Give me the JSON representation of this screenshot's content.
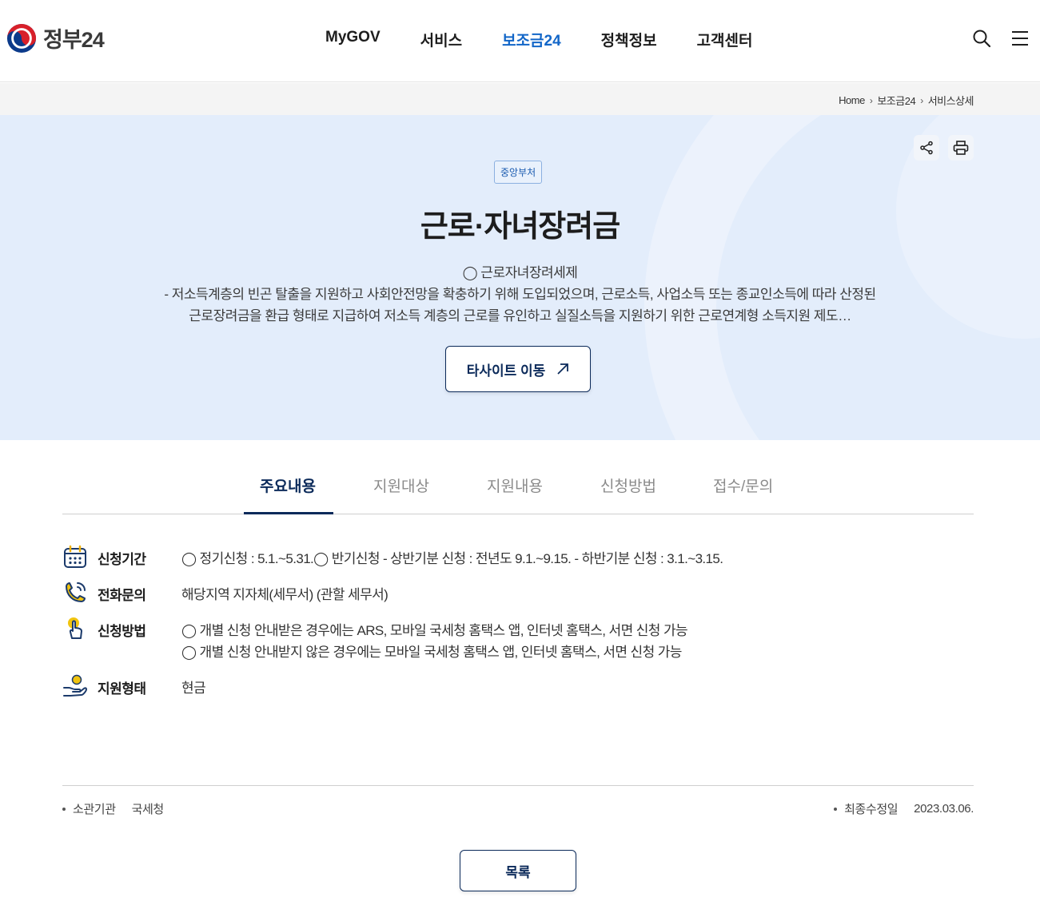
{
  "header": {
    "logo_text": "정부24",
    "nav": [
      "MyGOV",
      "서비스",
      "보조금24",
      "정책정보",
      "고객센터"
    ],
    "active_nav": "보조금24",
    "search_icon": "search-icon",
    "menu_icon": "hamburger-menu-icon"
  },
  "breadcrumb": [
    "Home",
    "보조금24",
    "서비스상세"
  ],
  "hero": {
    "badge": "중앙부처",
    "title": "근로·자녀장려금",
    "desc_line1": "◯ 근로자녀장려세제",
    "desc_line2": "- 저소득계층의 빈곤 탈출을 지원하고 사회안전망을 확충하기 위해 도입되었으며, 근로소득, 사업소득 또는 종교인소득에 따라 산정된",
    "desc_line3": "근로장려금을 환급 형태로 지급하여 저소득 계층의 근로를 유인하고 실질소득을 지원하기 위한 근로연계형 소득지원 제도…",
    "site_button": "타사이트 이동",
    "share_icon": "share-icon",
    "print_icon": "print-icon"
  },
  "tabs": [
    "주요내용",
    "지원대상",
    "지원내용",
    "신청방법",
    "접수/문의"
  ],
  "active_tab": "주요내용",
  "info": [
    {
      "icon": "calendar-icon",
      "label": "신청기간",
      "lines": [
        "◯ 정기신청 : 5.1.~5.31.◯ 반기신청 - 상반기분 신청 : 전년도 9.1.~9.15. - 하반기분 신청 : 3.1.~3.15."
      ]
    },
    {
      "icon": "phone-icon",
      "label": "전화문의",
      "lines": [
        "해당지역 지자체(세무서) (관할 세무서)"
      ]
    },
    {
      "icon": "hand-pointer-icon",
      "label": "신청방법",
      "lines": [
        "◯ 개별 신청 안내받은 경우에는 ARS, 모바일 국세청 홈택스 앱, 인터넷 홈택스, 서면 신청 가능",
        "◯ 개별 신청 안내받지 않은 경우에는 모바일 국세청 홈택스 앱, 인터넷 홈택스, 서면 신청 가능"
      ]
    },
    {
      "icon": "hand-coin-icon",
      "label": "지원형태",
      "lines": [
        "현금"
      ]
    }
  ],
  "meta": {
    "agency_label": "소관기관",
    "agency_value": "국세청",
    "updated_label": "최종수정일",
    "updated_value": "2023.03.06."
  },
  "list_button": "목록",
  "colors": {
    "accent": "#1266c8",
    "navy": "#0b2a5a",
    "hero_bg": "#e3edfb"
  }
}
